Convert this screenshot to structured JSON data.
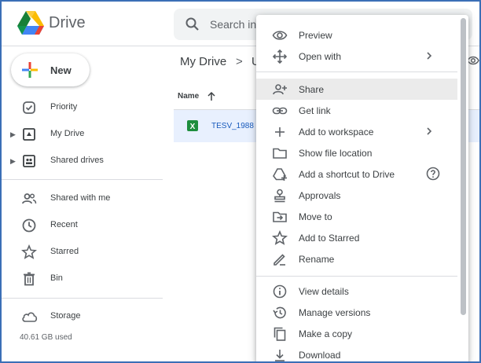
{
  "app": {
    "name": "Drive"
  },
  "search": {
    "placeholder": "Search in Drive"
  },
  "sidebar": {
    "new_label": "New",
    "items": [
      {
        "label": "Priority",
        "icon": "priority-icon"
      },
      {
        "label": "My Drive",
        "icon": "my-drive-icon"
      },
      {
        "label": "Shared drives",
        "icon": "shared-drives-icon"
      },
      {
        "label": "Shared with me",
        "icon": "shared-with-me-icon"
      },
      {
        "label": "Recent",
        "icon": "clock-icon"
      },
      {
        "label": "Starred",
        "icon": "star-icon"
      },
      {
        "label": "Bin",
        "icon": "bin-icon"
      },
      {
        "label": "Storage",
        "icon": "cloud-icon"
      }
    ],
    "storage_used": "40.61 GB used"
  },
  "main": {
    "breadcrumb_root": "My Drive",
    "breadcrumb_sep": ">",
    "breadcrumb_next": "U",
    "column_name": "Name",
    "file_name": "TESV_1988"
  },
  "context_menu": {
    "items": [
      {
        "label": "Preview",
        "icon": "eye-icon"
      },
      {
        "label": "Open with",
        "icon": "move-arrows-icon"
      },
      {
        "label": "Share",
        "icon": "person-add-icon"
      },
      {
        "label": "Get link",
        "icon": "link-icon"
      },
      {
        "label": "Add to workspace",
        "icon": "plus-icon"
      },
      {
        "label": "Show file location",
        "icon": "folder-icon"
      },
      {
        "label": "Add a shortcut to Drive",
        "icon": "add-shortcut-icon"
      },
      {
        "label": "Approvals",
        "icon": "approval-stamp-icon"
      },
      {
        "label": "Move to",
        "icon": "move-to-icon"
      },
      {
        "label": "Add to Starred",
        "icon": "star-icon"
      },
      {
        "label": "Rename",
        "icon": "pencil-icon"
      },
      {
        "label": "View details",
        "icon": "info-icon"
      },
      {
        "label": "Manage versions",
        "icon": "history-icon"
      },
      {
        "label": "Make a copy",
        "icon": "copy-icon"
      },
      {
        "label": "Download",
        "icon": "download-icon"
      }
    ],
    "highlighted": "Share"
  },
  "colors": {
    "accent_blue": "#185abc",
    "selected_row": "#e8f0fe",
    "menu_highlight": "#ebebeb",
    "frame_border": "#3b6fb6"
  }
}
